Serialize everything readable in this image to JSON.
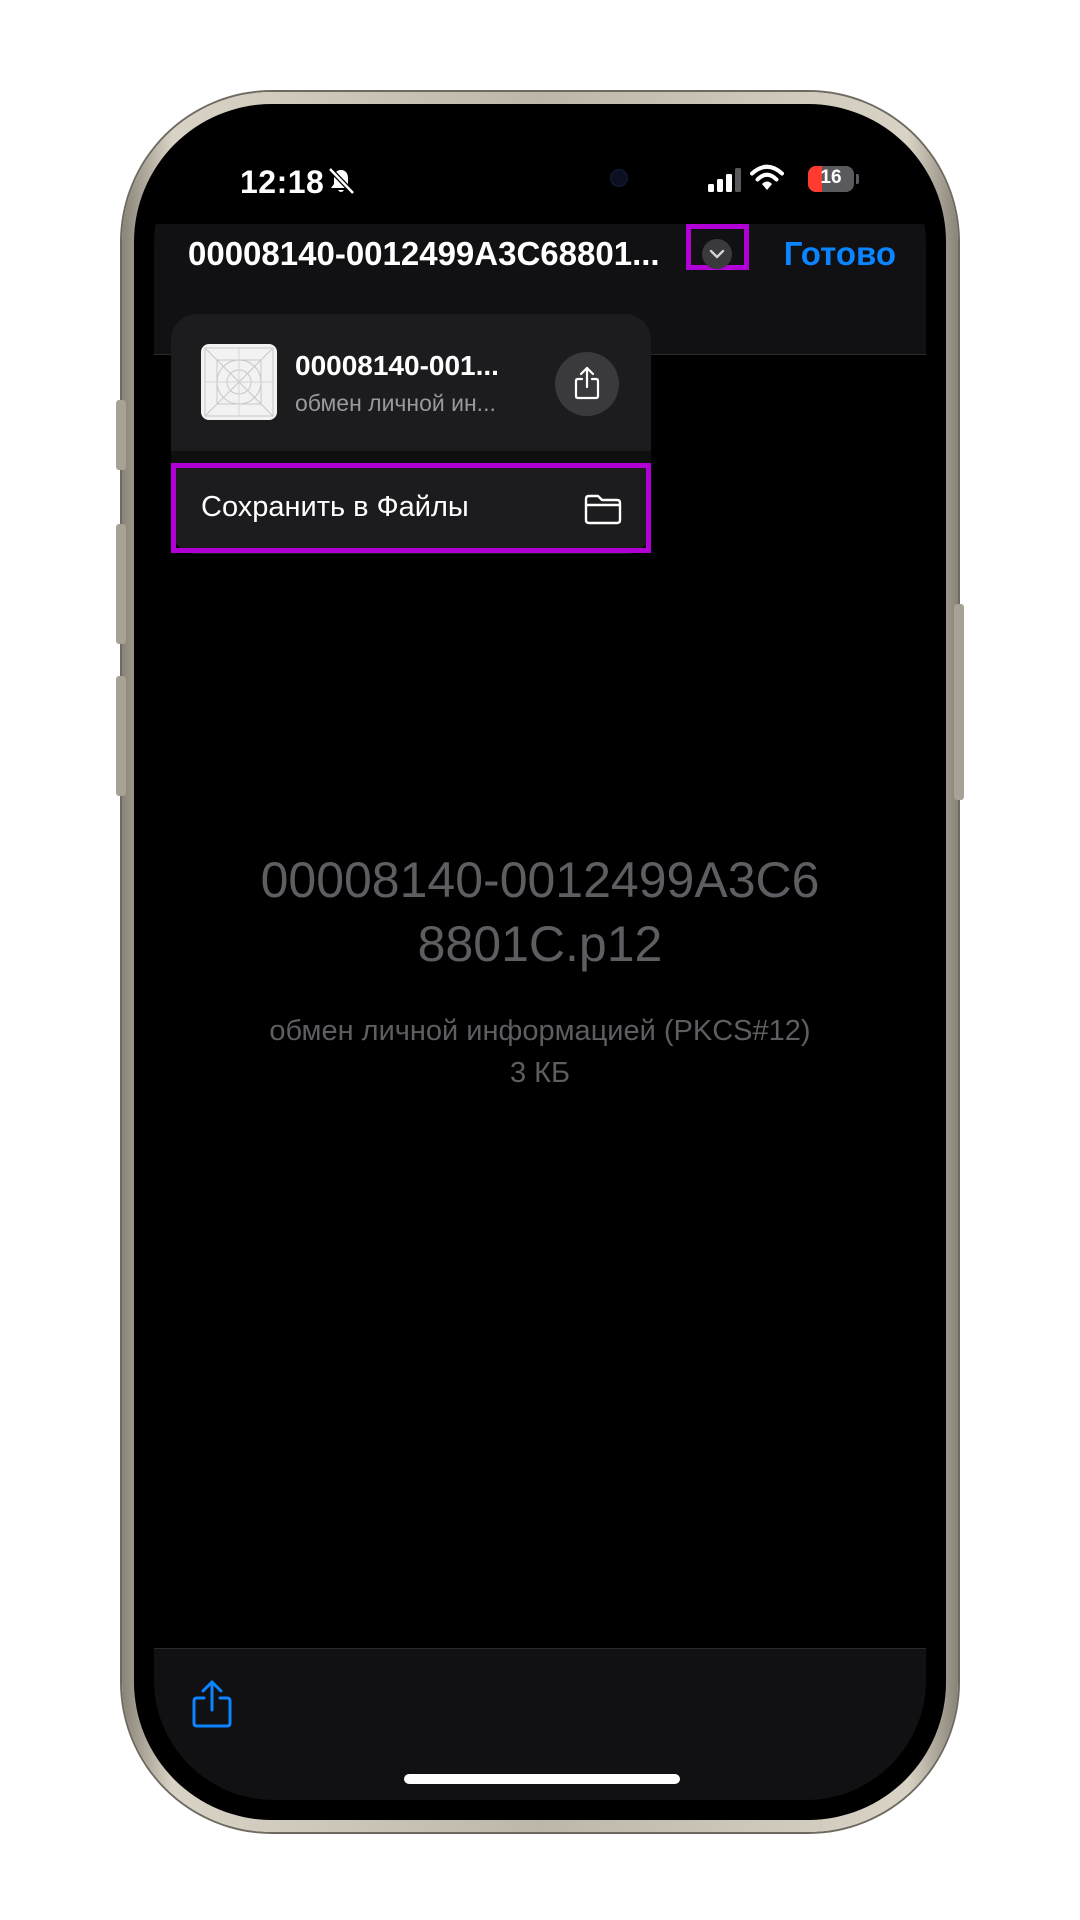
{
  "status_bar": {
    "time": "12:18",
    "battery_level": "16",
    "icons": [
      "bell-slash-icon",
      "signal-icon",
      "wifi-icon",
      "battery-icon"
    ]
  },
  "nav": {
    "title": "00008140-0012499A3C68801...",
    "done_label": "Готово",
    "chevron_icon": "chevron-down-icon"
  },
  "menu": {
    "file_name": "00008140-001...",
    "file_type": "обмен личной ин...",
    "share_icon": "share-icon",
    "save_label": "Сохранить в Файлы",
    "save_icon": "folder-icon"
  },
  "document": {
    "title_line1": "00008140-0012499A3C6",
    "title_line2": "8801C.p12",
    "type": "обмен личной информацией (PKCS#12)",
    "size": "3 КБ"
  },
  "toolbar": {
    "share_icon": "share-icon"
  },
  "colors": {
    "accent": "#0a84ff",
    "highlight": "#b000d6",
    "background": "#000000",
    "battery_low": "#ff3b30"
  }
}
